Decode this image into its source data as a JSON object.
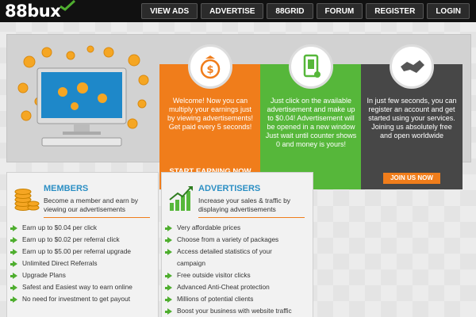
{
  "header": {
    "logo_text": "88bux",
    "nav": [
      "VIEW ADS",
      "ADVERTISE",
      "88GRID",
      "FORUM",
      "REGISTER",
      "LOGIN"
    ]
  },
  "hero": {
    "cards": [
      {
        "text": "Welcome! Now you can multiply your earnings just by viewing advertisements! Get paid every 5 seconds!",
        "cta": "START EARNING NOW",
        "icon": "money-bag-icon",
        "color": "#f07d1b"
      },
      {
        "text": "Just click on the available advertisement and make up to $0.04! Advertisement will be opened in a new window Just wait until counter shows 0 and money is yours!",
        "icon": "phone-tap-icon",
        "color": "#56b73a"
      },
      {
        "text": "In just few seconds, you can register an account and get started using your services. Joining us absolutely free and open worldwide",
        "cta": "JOIN US NOW",
        "icon": "handshake-icon",
        "color": "#474747"
      }
    ]
  },
  "members": {
    "title": "MEMBERS",
    "subtitle": "Become a member and earn by viewing our advertisements",
    "icon": "coin-stack-icon",
    "items": [
      "Earn up to $0.04 per click",
      "Earn up to $0.02 per referral click",
      "Earn up to $5.00 per referral upgrade",
      "Unlimited Direct Referrals",
      "Upgrade Plans",
      "Safest and Easiest way to earn online",
      "No need for investment to get payout"
    ]
  },
  "advertisers": {
    "title": "ADVERTISERS",
    "subtitle": "Increase your sales & traffic by displaying advertisements",
    "icon": "growth-chart-icon",
    "items": [
      "Very affordable prices",
      "Choose from a variety of packages",
      "Access detailed statistics of your",
      "campaign",
      "Free outside visitor clicks",
      "Advanced Anti-Cheat protection",
      "Millions of potential clients",
      "Boost your business with website traffic"
    ]
  },
  "colors": {
    "accent_blue": "#2c8fc4",
    "orange": "#f07d1b",
    "green": "#56b73a",
    "dark": "#474747"
  }
}
